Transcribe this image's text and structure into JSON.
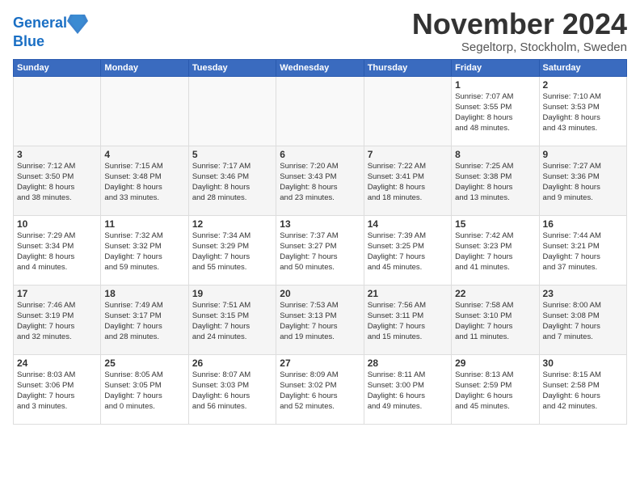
{
  "header": {
    "logo_line1": "General",
    "logo_line2": "Blue",
    "title": "November 2024",
    "subtitle": "Segeltorp, Stockholm, Sweden"
  },
  "weekdays": [
    "Sunday",
    "Monday",
    "Tuesday",
    "Wednesday",
    "Thursday",
    "Friday",
    "Saturday"
  ],
  "weeks": [
    [
      {
        "day": "",
        "info": ""
      },
      {
        "day": "",
        "info": ""
      },
      {
        "day": "",
        "info": ""
      },
      {
        "day": "",
        "info": ""
      },
      {
        "day": "",
        "info": ""
      },
      {
        "day": "1",
        "info": "Sunrise: 7:07 AM\nSunset: 3:55 PM\nDaylight: 8 hours\nand 48 minutes."
      },
      {
        "day": "2",
        "info": "Sunrise: 7:10 AM\nSunset: 3:53 PM\nDaylight: 8 hours\nand 43 minutes."
      }
    ],
    [
      {
        "day": "3",
        "info": "Sunrise: 7:12 AM\nSunset: 3:50 PM\nDaylight: 8 hours\nand 38 minutes."
      },
      {
        "day": "4",
        "info": "Sunrise: 7:15 AM\nSunset: 3:48 PM\nDaylight: 8 hours\nand 33 minutes."
      },
      {
        "day": "5",
        "info": "Sunrise: 7:17 AM\nSunset: 3:46 PM\nDaylight: 8 hours\nand 28 minutes."
      },
      {
        "day": "6",
        "info": "Sunrise: 7:20 AM\nSunset: 3:43 PM\nDaylight: 8 hours\nand 23 minutes."
      },
      {
        "day": "7",
        "info": "Sunrise: 7:22 AM\nSunset: 3:41 PM\nDaylight: 8 hours\nand 18 minutes."
      },
      {
        "day": "8",
        "info": "Sunrise: 7:25 AM\nSunset: 3:38 PM\nDaylight: 8 hours\nand 13 minutes."
      },
      {
        "day": "9",
        "info": "Sunrise: 7:27 AM\nSunset: 3:36 PM\nDaylight: 8 hours\nand 9 minutes."
      }
    ],
    [
      {
        "day": "10",
        "info": "Sunrise: 7:29 AM\nSunset: 3:34 PM\nDaylight: 8 hours\nand 4 minutes."
      },
      {
        "day": "11",
        "info": "Sunrise: 7:32 AM\nSunset: 3:32 PM\nDaylight: 7 hours\nand 59 minutes."
      },
      {
        "day": "12",
        "info": "Sunrise: 7:34 AM\nSunset: 3:29 PM\nDaylight: 7 hours\nand 55 minutes."
      },
      {
        "day": "13",
        "info": "Sunrise: 7:37 AM\nSunset: 3:27 PM\nDaylight: 7 hours\nand 50 minutes."
      },
      {
        "day": "14",
        "info": "Sunrise: 7:39 AM\nSunset: 3:25 PM\nDaylight: 7 hours\nand 45 minutes."
      },
      {
        "day": "15",
        "info": "Sunrise: 7:42 AM\nSunset: 3:23 PM\nDaylight: 7 hours\nand 41 minutes."
      },
      {
        "day": "16",
        "info": "Sunrise: 7:44 AM\nSunset: 3:21 PM\nDaylight: 7 hours\nand 37 minutes."
      }
    ],
    [
      {
        "day": "17",
        "info": "Sunrise: 7:46 AM\nSunset: 3:19 PM\nDaylight: 7 hours\nand 32 minutes."
      },
      {
        "day": "18",
        "info": "Sunrise: 7:49 AM\nSunset: 3:17 PM\nDaylight: 7 hours\nand 28 minutes."
      },
      {
        "day": "19",
        "info": "Sunrise: 7:51 AM\nSunset: 3:15 PM\nDaylight: 7 hours\nand 24 minutes."
      },
      {
        "day": "20",
        "info": "Sunrise: 7:53 AM\nSunset: 3:13 PM\nDaylight: 7 hours\nand 19 minutes."
      },
      {
        "day": "21",
        "info": "Sunrise: 7:56 AM\nSunset: 3:11 PM\nDaylight: 7 hours\nand 15 minutes."
      },
      {
        "day": "22",
        "info": "Sunrise: 7:58 AM\nSunset: 3:10 PM\nDaylight: 7 hours\nand 11 minutes."
      },
      {
        "day": "23",
        "info": "Sunrise: 8:00 AM\nSunset: 3:08 PM\nDaylight: 7 hours\nand 7 minutes."
      }
    ],
    [
      {
        "day": "24",
        "info": "Sunrise: 8:03 AM\nSunset: 3:06 PM\nDaylight: 7 hours\nand 3 minutes."
      },
      {
        "day": "25",
        "info": "Sunrise: 8:05 AM\nSunset: 3:05 PM\nDaylight: 7 hours\nand 0 minutes."
      },
      {
        "day": "26",
        "info": "Sunrise: 8:07 AM\nSunset: 3:03 PM\nDaylight: 6 hours\nand 56 minutes."
      },
      {
        "day": "27",
        "info": "Sunrise: 8:09 AM\nSunset: 3:02 PM\nDaylight: 6 hours\nand 52 minutes."
      },
      {
        "day": "28",
        "info": "Sunrise: 8:11 AM\nSunset: 3:00 PM\nDaylight: 6 hours\nand 49 minutes."
      },
      {
        "day": "29",
        "info": "Sunrise: 8:13 AM\nSunset: 2:59 PM\nDaylight: 6 hours\nand 45 minutes."
      },
      {
        "day": "30",
        "info": "Sunrise: 8:15 AM\nSunset: 2:58 PM\nDaylight: 6 hours\nand 42 minutes."
      }
    ]
  ]
}
